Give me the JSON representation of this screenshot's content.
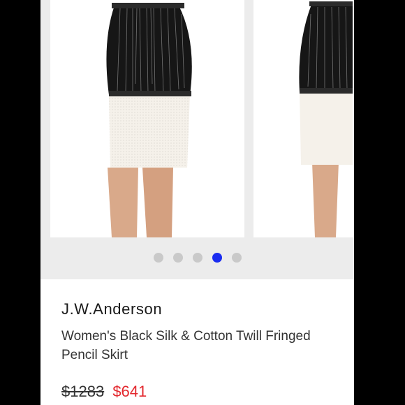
{
  "product": {
    "brand": "J.W.Anderson",
    "title": "Women's Black Silk & Cotton Twill Fringed Pencil Skirt",
    "original_price": "$1283",
    "sale_price": "$641"
  },
  "carousel": {
    "total_slides": 5,
    "active_slide": 4,
    "dots": [
      {
        "active": false
      },
      {
        "active": false
      },
      {
        "active": false
      },
      {
        "active": true
      },
      {
        "active": false
      }
    ],
    "colors": {
      "dot_inactive": "#c9c9c9",
      "dot_active": "#1a2cf0"
    }
  },
  "colors": {
    "sale_price": "#e3272d",
    "background": "#000000"
  }
}
